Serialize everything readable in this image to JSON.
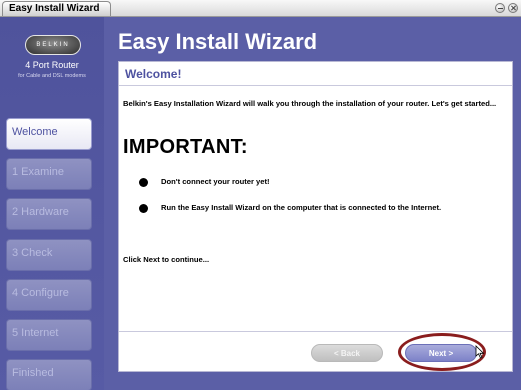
{
  "window": {
    "title": "Easy Install Wizard"
  },
  "sidebar": {
    "brand": "BELKIN",
    "product_name": "4 Port Router",
    "product_sub": "for Cable and DSL modems",
    "steps": [
      {
        "label": "Welcome",
        "active": true
      },
      {
        "label": "1 Examine",
        "active": false
      },
      {
        "label": "2 Hardware",
        "active": false
      },
      {
        "label": "3 Check",
        "active": false
      },
      {
        "label": "4 Configure",
        "active": false
      },
      {
        "label": "5 Internet",
        "active": false
      },
      {
        "label": "Finished",
        "active": false
      }
    ]
  },
  "header": {
    "title": "Easy Install Wizard"
  },
  "panel": {
    "title": "Welcome!",
    "intro": "Belkin's Easy Installation Wizard will walk you through the installation of your router. Let's get started...",
    "important": "IMPORTANT:",
    "bullets": [
      "Don't connect your router yet!",
      "Run the Easy Install Wizard on the computer that is connected to the Internet."
    ],
    "continue_prefix": "Click ",
    "continue_key": "Next",
    "continue_suffix": " to continue..."
  },
  "buttons": {
    "back": "< Back",
    "next": "Next >"
  },
  "colors": {
    "background": "#5b5fa6",
    "accent": "#4e52a0",
    "highlight_ring": "#8a1d1d"
  }
}
